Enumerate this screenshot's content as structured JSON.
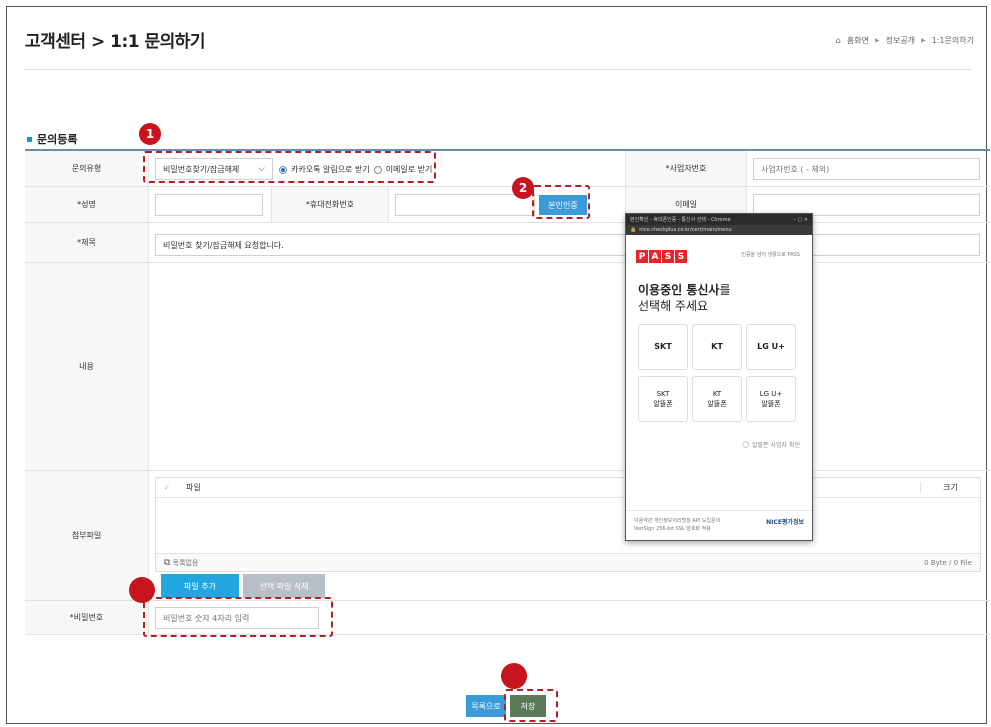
{
  "header": {
    "page_title": "고객센터 > 1:1 문의하기",
    "breadcrumb": [
      "홈화면",
      "정보공개",
      "1:1문의하기"
    ]
  },
  "section": {
    "title": "문의등록"
  },
  "form": {
    "inquiry_type": {
      "label": "문의유형",
      "selected": "비밀번호찾기/잠금해제",
      "radio_options": [
        "카카오톡 알림으로 받기",
        "이메일로 받기"
      ],
      "radio_selected_index": 0
    },
    "business_no": {
      "label": "*사업자번호",
      "placeholder": "사업자번호 ( - 제외)"
    },
    "name": {
      "label": "*성명",
      "value": ""
    },
    "mobile": {
      "label": "*휴대전화번호",
      "value": "",
      "verify_button": "본인인증"
    },
    "email": {
      "label": "이메일",
      "value": ""
    },
    "subject": {
      "label": "*제목",
      "value": "비밀번호 찾기/잠금해제 요청합니다."
    },
    "content": {
      "label": "내용"
    },
    "attachment": {
      "label": "첨부파일",
      "col_file": "파일",
      "col_size": "크기",
      "footer_left": "목록없음",
      "footer_right": "0 Byte / 0 File",
      "add_button": "파일 추가",
      "delete_button": "선택 파일 삭제"
    },
    "password": {
      "label": "*비밀번호",
      "placeholder": "비밀번호 숫자 4자리 입력"
    }
  },
  "buttons": {
    "list": "목록으로",
    "save": "저장"
  },
  "badges": [
    "1",
    "2",
    "",
    ""
  ],
  "popup": {
    "titlebar": "본인확인 - 휴대폰인증 - 통신사 선택 - Chrome",
    "url": "nice.checkplus.co.kr/cert/main/menu",
    "logo": [
      "P",
      "A",
      "S",
      "S"
    ],
    "tagline": "인증을 넘어 생활으로 PASS",
    "heading_bold": "이용중인 통신사",
    "heading_rest": "를",
    "heading_line2": "선택해 주세요",
    "carriers": [
      "SKT",
      "KT",
      "LG U+"
    ],
    "mvno": [
      {
        "name": "SKT",
        "sub": "알뜰폰"
      },
      {
        "name": "KT",
        "sub": "알뜰폰"
      },
      {
        "name": "LG U+",
        "sub": "알뜰폰"
      }
    ],
    "mvno_check": "알뜰폰 사업자 확인",
    "footer_line1": "이용약관  개인정보처리방침  API 도입문의",
    "footer_line2": "VeriSign 256-bit SSL 암호화 적용",
    "provider": "NICE평가정보"
  },
  "colors": {
    "accent_blue": "#1a8fd6",
    "annotation_red": "#c8141e",
    "pass_red": "#e2262a"
  }
}
